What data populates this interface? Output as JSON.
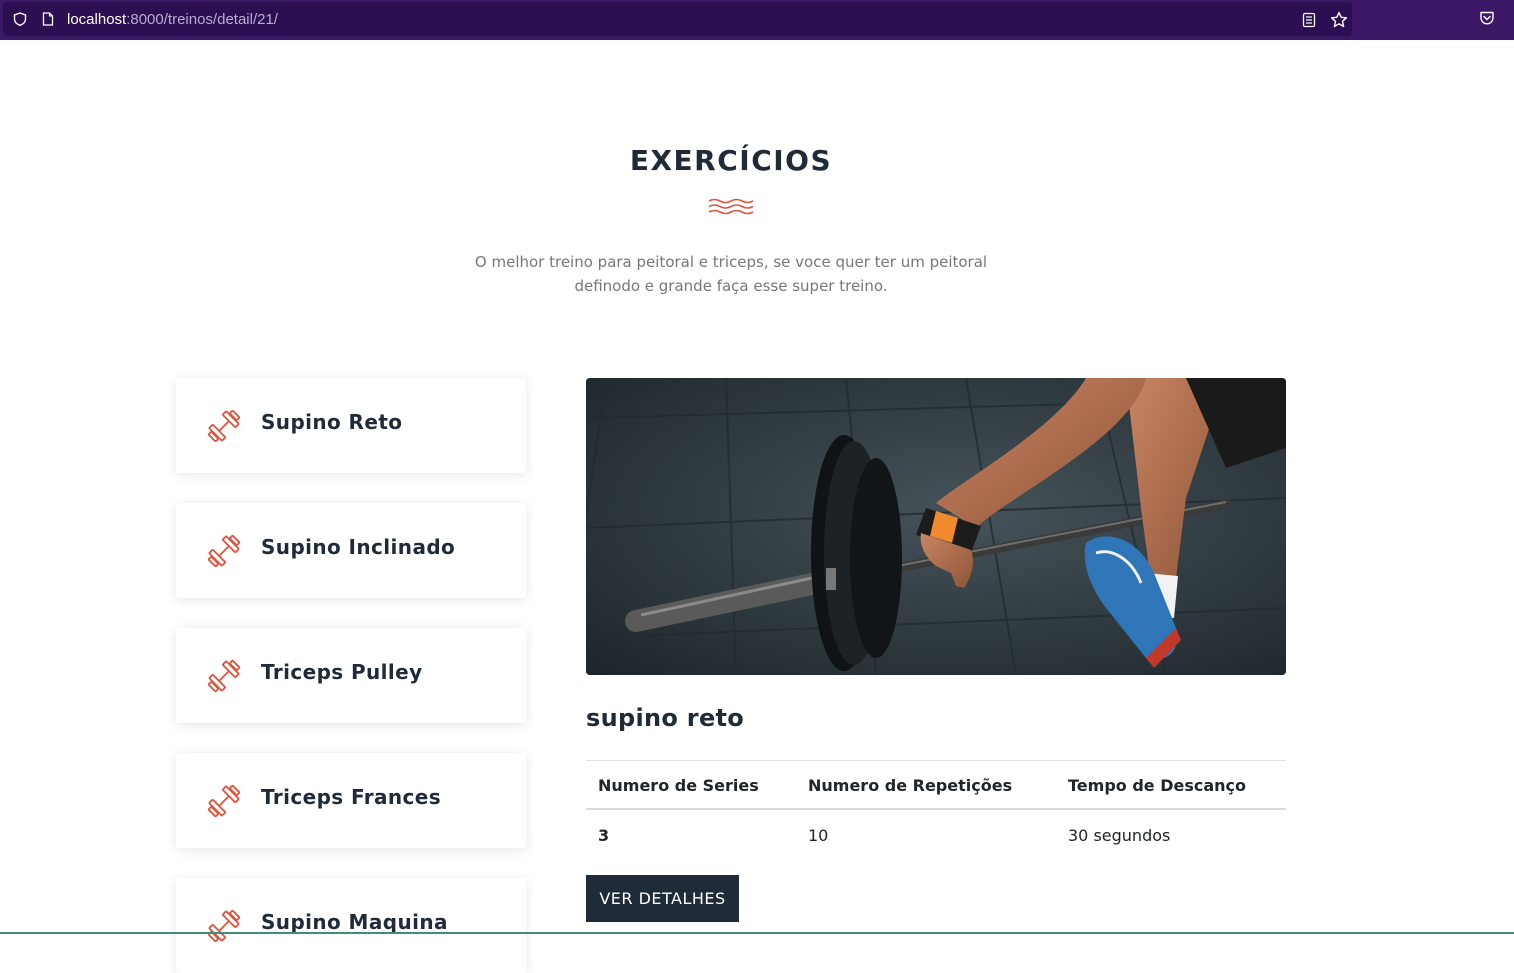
{
  "browser": {
    "url_host": "localhost",
    "url_path": ":8000/treinos/detail/21/"
  },
  "section": {
    "title": "EXERCÍCIOS",
    "description_line1": "O melhor treino para peitoral e triceps, se voce quer ter um peitoral",
    "description_line2": "definodo e grande faça esse super treino."
  },
  "exercises": [
    {
      "label": "Supino Reto",
      "icon": "dumbbell-icon"
    },
    {
      "label": "Supino Inclinado",
      "icon": "dumbbell-icon"
    },
    {
      "label": "Triceps Pulley",
      "icon": "dumbbell-icon"
    },
    {
      "label": "Triceps Frances",
      "icon": "dumbbell-icon"
    },
    {
      "label": "Supino Maquina",
      "icon": "dumbbell-icon"
    }
  ],
  "detail": {
    "name": "supino reto",
    "table": {
      "headers": [
        "Numero de Series",
        "Numero de Repetições",
        "Tempo de Descanço"
      ],
      "row": [
        "3",
        "10",
        "30 segundos"
      ]
    },
    "button_label": "VER DETALHES"
  },
  "colors": {
    "accent": "#e0533d",
    "dark": "#1f2b38",
    "browser_toolbar": "#3b1766"
  }
}
